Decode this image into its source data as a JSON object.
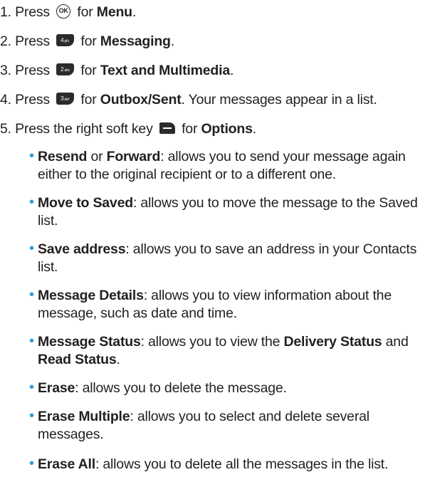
{
  "steps": [
    {
      "num": "1.",
      "pre": "Press",
      "key": "OK",
      "mid": "for",
      "bold": "Menu",
      "post": "."
    },
    {
      "num": "2.",
      "pre": "Press",
      "key": "4ghi",
      "mid": "for",
      "bold": "Messaging",
      "post": "."
    },
    {
      "num": "3.",
      "pre": "Press",
      "key": "2abc",
      "mid": "for",
      "bold": "Text and Multimedia",
      "post": "."
    },
    {
      "num": "4.",
      "pre": "Press",
      "key": "3def",
      "mid": "for",
      "bold": "Outbox/Sent",
      "post": ". Your messages appear in a list."
    },
    {
      "num": "5.",
      "pre": "Press the right soft key",
      "key": "right-soft-key",
      "mid": "for",
      "bold": "Options",
      "post": "."
    }
  ],
  "options": [
    {
      "b1": "Resend",
      "t1": " or ",
      "b2": "Forward",
      "t2": ": allows you to send your message again either to the original recipient or to a different one."
    },
    {
      "b1": "Move to Saved",
      "t1": ": allows you to move the message to the Saved list."
    },
    {
      "b1": "Save address",
      "t1": ": allows you to save an address in your Contacts list."
    },
    {
      "b1": "Message Details",
      "t1": ": allows you to view information about the message, such as date and time."
    },
    {
      "b1": "Message Status",
      "t1": ": allows you to view the ",
      "b2": "Delivery Status",
      "t2": " and ",
      "b3": "Read Status",
      "t3": "."
    },
    {
      "b1": "Erase",
      "t1": ": allows you to delete the message."
    },
    {
      "b1": "Erase Multiple",
      "t1": ": allows you to select and delete several messages."
    },
    {
      "b1": "Erase All",
      "t1": ": allows you to delete all the messages in the list."
    }
  ],
  "colors": {
    "bullet": "#2b9bd6",
    "text": "#231f20"
  }
}
